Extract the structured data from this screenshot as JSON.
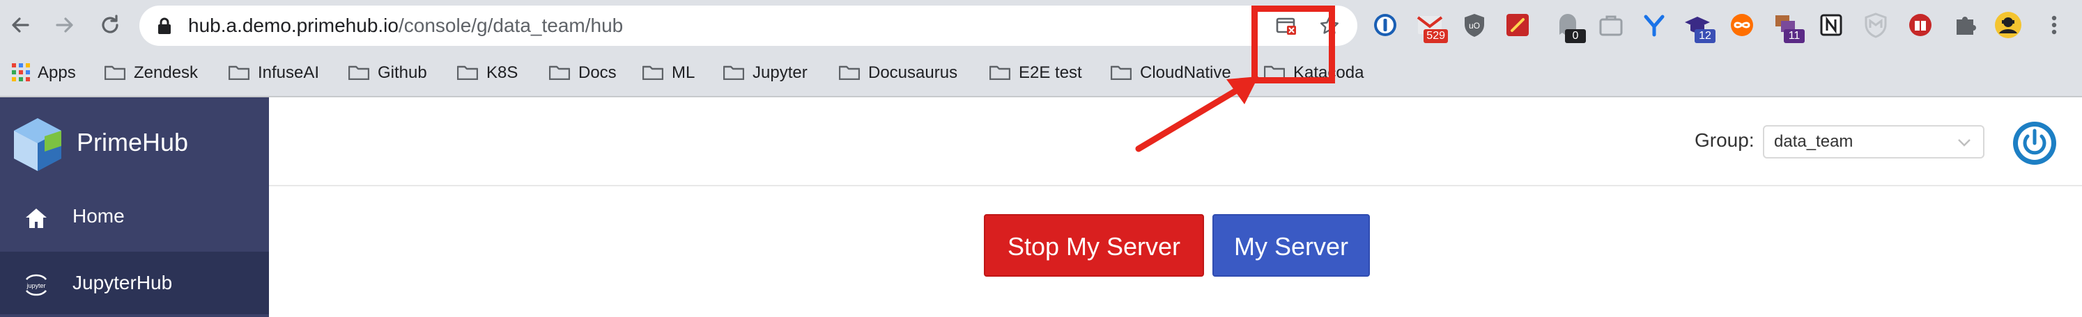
{
  "browser": {
    "url_host": "hub.a.demo.primehub.io",
    "url_path": "/console/g/data_team/hub",
    "extensions": [
      {
        "name": "onepassword-icon",
        "badge": ""
      },
      {
        "name": "gmail-icon",
        "badge": "529",
        "badge_color": "#d93025"
      },
      {
        "name": "ublock-icon",
        "badge": ""
      },
      {
        "name": "colorzilla-icon",
        "badge": ""
      },
      {
        "name": "ghostery-icon",
        "badge": "0",
        "badge_color": "#202124"
      },
      {
        "name": "briefcase-icon",
        "badge": ""
      },
      {
        "name": "yoast-icon",
        "badge": ""
      },
      {
        "name": "graduation-icon",
        "badge": "12",
        "badge_color": "#3a4fb5"
      },
      {
        "name": "infinity-icon",
        "badge": ""
      },
      {
        "name": "multi-window-icon",
        "badge": "11",
        "badge_color": "#5b2a86"
      },
      {
        "name": "notion-icon",
        "badge": ""
      },
      {
        "name": "mcafee-icon",
        "badge": ""
      },
      {
        "name": "reader-icon",
        "badge": ""
      },
      {
        "name": "puzzle-icon",
        "badge": ""
      },
      {
        "name": "profile-avatar-icon",
        "badge": ""
      }
    ]
  },
  "bookmarks": [
    "Apps",
    "Zendesk",
    "InfuseAI",
    "Github",
    "K8S",
    "Docs",
    "ML",
    "Jupyter",
    "Docusaurus",
    "E2E test",
    "CloudNative",
    "Katacoda"
  ],
  "sidebar": {
    "brand": "PrimeHub",
    "items": [
      {
        "label": "Home",
        "icon": "home-icon"
      },
      {
        "label": "JupyterHub",
        "icon": "jupyter-icon"
      }
    ]
  },
  "header": {
    "group_label": "Group:",
    "group_value": "data_team"
  },
  "main": {
    "stop_label": "Stop My Server",
    "my_server_label": "My Server"
  },
  "colors": {
    "sidebar": "#3b4169",
    "sidebar_active": "#2c3356",
    "stop_button": "#d91f1f",
    "my_server_button": "#3a5ac4",
    "power_button": "#1d7fc4",
    "annotation": "#e8261c"
  }
}
